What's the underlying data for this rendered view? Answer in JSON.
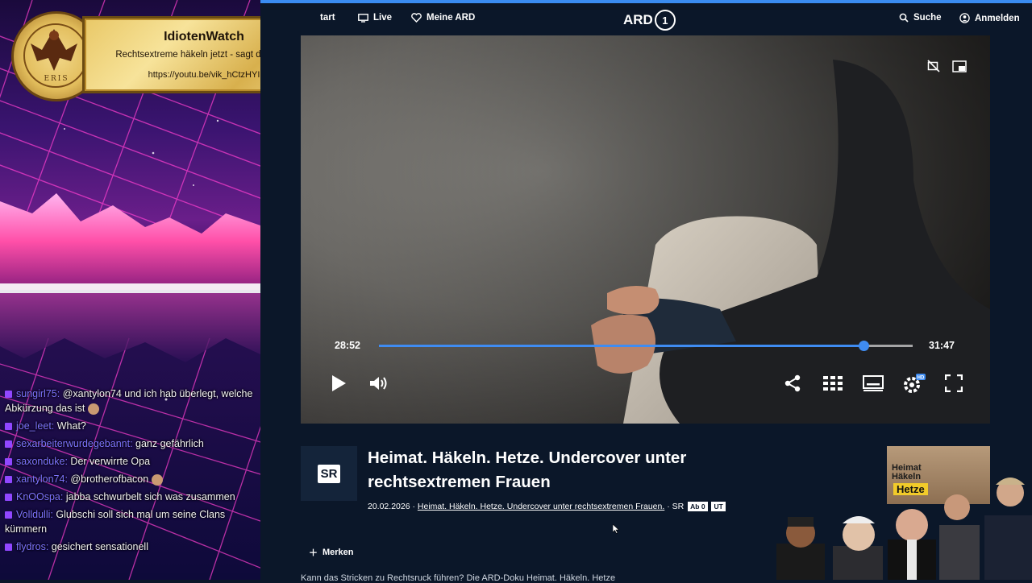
{
  "plaque": {
    "title": "IdiotenWatch",
    "subtitle": "Rechtsextreme häkeln jetzt - sagt der ÖRR",
    "url": "https://youtu.be/vik_hCtzHYI",
    "seal_text": "ERIS"
  },
  "chat": [
    {
      "user": "sungirl75",
      "message": "@xantylon74 und ich hab überlegt, welche Abkürzung das ist",
      "emote": true
    },
    {
      "user": "joe_leet",
      "message": "What?",
      "emote": false
    },
    {
      "user": "sexarbeiterwurdegebannt",
      "message": "ganz gefährlich",
      "emote": false
    },
    {
      "user": "saxonduke",
      "message": "Der verwirrte Opa",
      "emote": false
    },
    {
      "user": "xantylon74",
      "message": "@brotherofbacon",
      "emote": true
    },
    {
      "user": "KnOOspa",
      "message": "jabba schwurbelt sich was zusammen",
      "emote": false
    },
    {
      "user": "Volldulli",
      "message": "Glubschi soll sich mal um seine Clans kümmern",
      "emote": false
    },
    {
      "user": "flydros",
      "message": "gesichert sensationell",
      "emote": false
    }
  ],
  "nav": {
    "start": "tart",
    "live": "Live",
    "meine_ard": "Meine ARD",
    "logo": "ARD",
    "logo_one": "1",
    "search": "Suche",
    "login": "Anmelden"
  },
  "player": {
    "current_time": "28:52",
    "duration": "31:47",
    "progress": 0.908,
    "buffered": 0.93
  },
  "video": {
    "broadcaster": "SR",
    "title": "Heimat. Häkeln. Hetze. Undercover unter rechtsextremen Frauen",
    "date": "20.02.2026 ·",
    "series_link": "Heimat. Häkeln. Hetze. Undercover unter rechtsextremen Frauen.",
    "channel": "· SR",
    "tag_ab": "Ab 0",
    "tag_ut": "UT",
    "bookmark_label": "Merken",
    "description": "Kann das Stricken zu Rechtsruck führen? Die ARD-Doku Heimat. Häkeln. Hetze"
  },
  "thumbnail": {
    "title_line1": "Heimat",
    "title_line2": "Häkeln",
    "title_highlight": "Hetze"
  },
  "colors": {
    "accent": "#3f8cf2",
    "page_bg": "#0b1729",
    "chat_user": "#7e74ff",
    "plaque_gold": "#e9c867"
  }
}
